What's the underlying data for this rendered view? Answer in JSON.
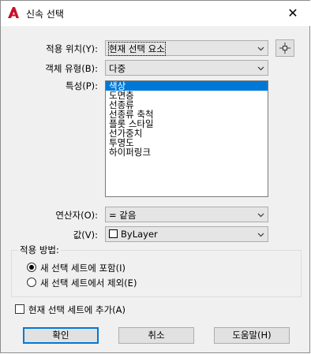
{
  "window": {
    "title": "신속 선택",
    "close_glyph": "✕"
  },
  "labels": {
    "apply_to": "적용 위치(Y):",
    "object_type": "객체 유형(B):",
    "properties": "특성(P):",
    "operator": "연산자(O):",
    "value": "값(V):"
  },
  "apply_to": {
    "value": "현재 선택 요소"
  },
  "object_type": {
    "value": "다중"
  },
  "properties": {
    "items": [
      "색상",
      "도면층",
      "선종류",
      "선종류 축척",
      "플롯 스타일",
      "선가중치",
      "투명도",
      "하이퍼링크"
    ],
    "selected_index": 0
  },
  "operator": {
    "value": "= 같음"
  },
  "value": {
    "value": "ByLayer",
    "swatch_color": "#ffffff"
  },
  "how_to_apply": {
    "label": "적용 방법:",
    "include_label": "새 선택 세트에 포함(I)",
    "exclude_label": "새 선택 세트에서 제외(E)",
    "selected": "include"
  },
  "append_checkbox": {
    "label": "현재 선택 세트에 추가(A)",
    "checked": false
  },
  "buttons": {
    "ok": "확인",
    "cancel": "취소",
    "help": "도움말(H)"
  },
  "colors": {
    "accent": "#0078d7",
    "app_icon": "#c8102e"
  }
}
